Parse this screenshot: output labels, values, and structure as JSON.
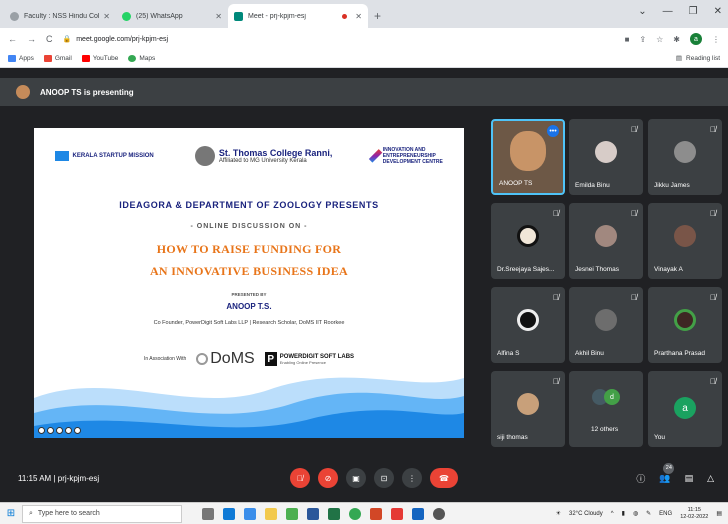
{
  "browser": {
    "tabs": [
      {
        "title": "Faculty : NSS Hindu College",
        "active": false
      },
      {
        "title": "(25) WhatsApp",
        "active": false
      },
      {
        "title": "Meet - prj-kpjm-esj",
        "active": true
      }
    ],
    "url": "meet.google.com/prj-kpjm-esj",
    "profile_initial": "a",
    "bookmarks": [
      "Apps",
      "Gmail",
      "YouTube",
      "Maps"
    ],
    "reading_list": "Reading list"
  },
  "meet": {
    "presenting_text": "ANOOP TS is presenting",
    "time": "11:15 AM",
    "meeting_code": "prj-kpjm-esj",
    "participant_count": "24",
    "participants": [
      {
        "name": "ANOOP TS"
      },
      {
        "name": "Emilda Binu"
      },
      {
        "name": "Jikku James"
      },
      {
        "name": "Dr.Sreejaya Sajes..."
      },
      {
        "name": "Jesnei Thomas"
      },
      {
        "name": "Vinayak A"
      },
      {
        "name": "Alfina S"
      },
      {
        "name": "Akhil Binu"
      },
      {
        "name": "Prarthana Prasad"
      },
      {
        "name": "siji thomas"
      },
      {
        "name": "12 others",
        "avatar_letter": "d"
      },
      {
        "name": "You",
        "avatar_letter": "a"
      }
    ]
  },
  "slide": {
    "logo1": "KERALA STARTUP MISSION",
    "logo2_title": "St. Thomas College Ranni,",
    "logo2_sub": "Affiliated to MG University Kerala",
    "logo3": "INNOVATION AND ENTREPRENEURSHIP DEVELOPMENT CENTRE",
    "line1": "IDEAGORA & DEPARTMENT OF ZOOLOGY PRESENTS",
    "line2": "- ONLINE DISCUSSION ON -",
    "line3": "HOW TO RAISE FUNDING FOR",
    "line4": "AN INNOVATIVE BUSINESS IDEA",
    "presented_by": "PRESENTED BY",
    "presenter": "ANOOP T.S.",
    "presenter_role": "Co Founder, PowerDigit Soft Labs LLP | Research Scholar, DoMS IIT Roorkee",
    "assoc": "In Association With",
    "doms": "DoMS",
    "pd_name": "POWERDIGIT SOFT LABS",
    "pd_tag": "Enabling Online Presence"
  },
  "taskbar": {
    "search_placeholder": "Type here to search",
    "weather": "32°C Cloudy",
    "lang": "ENG",
    "clock_time": "11:15",
    "clock_date": "12-02-2022"
  }
}
